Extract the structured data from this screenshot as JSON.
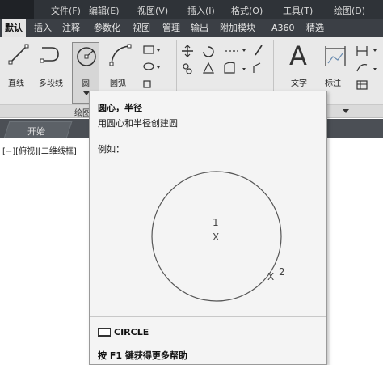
{
  "menu": {
    "items": [
      "文件(F)",
      "编辑(E)",
      "视图(V)",
      "插入(I)",
      "格式(O)",
      "工具(T)",
      "绘图(D)"
    ]
  },
  "ribbon_tabs": {
    "items": [
      "默认",
      "插入",
      "注释",
      "参数化",
      "视图",
      "管理",
      "输出",
      "附加模块",
      "A360",
      "精选"
    ],
    "active": "默认"
  },
  "ribbon": {
    "line_label": "直线",
    "polyline_label": "多段线",
    "circle_label": "圆",
    "arc_label": "圆弧",
    "text_label": "文字",
    "dimension_label": "标注",
    "draw_panel_label": "绘图"
  },
  "file_tab": {
    "label": "开始"
  },
  "viewport": {
    "label": "[−][俯视][二维线框]"
  },
  "tooltip": {
    "title": "圆心，半径",
    "description": "用圆心和半径创建圆",
    "example_label": "例如：",
    "point1": "1",
    "point2": "2",
    "marker": "X",
    "command": "CIRCLE",
    "help": "按 F1 键获得更多帮助"
  },
  "colors": {
    "menubar": "#2f3338",
    "ribbon_tabs": "#3b3f45",
    "ribbon": "#e9e9e9",
    "tooltip_bg": "#f4f4f4",
    "filetabs": "#4b4f55"
  }
}
